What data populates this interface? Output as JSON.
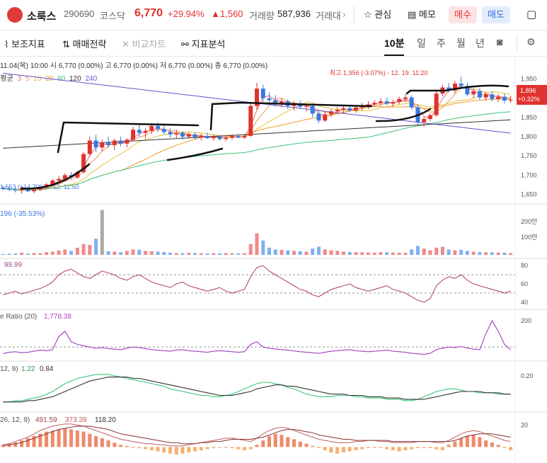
{
  "header": {
    "stock_name": "소룩스",
    "code": "290690",
    "market": "코스닥",
    "price": "6,770",
    "change_pct": "+29.94%",
    "change_amt": "1,560",
    "volume_label": "거래량",
    "volume": "587,936",
    "truncated_label": "거래대",
    "favorite_label": "관심",
    "memo_label": "메모",
    "buy_label": "매수",
    "sell_label": "매도"
  },
  "toolbar": {
    "aux_indicator": "보조지표",
    "trade_strategy": "매매전략",
    "compare_chart": "비교차트",
    "indicator_analysis": "지표분석",
    "timeframes": [
      "10분",
      "일",
      "주",
      "월",
      "년"
    ],
    "active_timeframe": "10분"
  },
  "colors": {
    "up": "#e0322f",
    "down": "#3a78e0",
    "ma3": "#e86d6d",
    "ma5": "#e89a5a",
    "ma10": "#e2c23a",
    "ma20": "#ef9c2a",
    "ma60": "#3cc47a",
    "ma120": "#333333",
    "ma240": "#6a4fd0"
  },
  "chart_data": [
    {
      "type": "candlestick",
      "info_line": "11.04(목) 10:00 시 6,770 (0.00%)  고 6,770 (0.00%)  저 6,770 (0.00%)  종 6,770 (0.00%)",
      "ma_label": "이동평균",
      "ma_periods": [
        "3",
        "5",
        "10",
        "20",
        "60",
        "120",
        "240"
      ],
      "y_ticks": [
        "1,950",
        "1,900",
        "1,850",
        "1,800",
        "1,750",
        "1,700",
        "1,650"
      ],
      "ylim": [
        1640,
        1975
      ],
      "high_annotation": "최고 1,956 (-3.07%) - 12. 19. 11:20",
      "low_annotation": "1,653 (+14.70%) - 12. 11:50",
      "price_tag": "1,896",
      "price_tag_pct": "+0.32%",
      "ohlc": [
        [
          1668,
          1672,
          1660,
          1665
        ],
        [
          1665,
          1670,
          1658,
          1662
        ],
        [
          1662,
          1668,
          1655,
          1660
        ],
        [
          1660,
          1667,
          1652,
          1664
        ],
        [
          1664,
          1670,
          1656,
          1658
        ],
        [
          1658,
          1665,
          1653,
          1662
        ],
        [
          1662,
          1670,
          1658,
          1668
        ],
        [
          1668,
          1680,
          1664,
          1676
        ],
        [
          1676,
          1690,
          1670,
          1686
        ],
        [
          1686,
          1698,
          1680,
          1690
        ],
        [
          1690,
          1705,
          1684,
          1700
        ],
        [
          1700,
          1708,
          1690,
          1694
        ],
        [
          1694,
          1712,
          1690,
          1708
        ],
        [
          1708,
          1760,
          1704,
          1755
        ],
        [
          1755,
          1800,
          1748,
          1790
        ],
        [
          1790,
          1805,
          1760,
          1772
        ],
        [
          1772,
          1792,
          1762,
          1785
        ],
        [
          1785,
          1800,
          1770,
          1778
        ],
        [
          1778,
          1795,
          1765,
          1790
        ],
        [
          1790,
          1800,
          1775,
          1782
        ],
        [
          1782,
          1796,
          1772,
          1792
        ],
        [
          1792,
          1825,
          1788,
          1818
        ],
        [
          1818,
          1832,
          1800,
          1810
        ],
        [
          1810,
          1822,
          1795,
          1815
        ],
        [
          1815,
          1835,
          1808,
          1828
        ],
        [
          1828,
          1838,
          1812,
          1820
        ],
        [
          1820,
          1830,
          1806,
          1812
        ],
        [
          1812,
          1822,
          1798,
          1806
        ],
        [
          1806,
          1818,
          1796,
          1810
        ],
        [
          1810,
          1815,
          1792,
          1800
        ],
        [
          1800,
          1812,
          1794,
          1806
        ],
        [
          1806,
          1812,
          1792,
          1798
        ],
        [
          1798,
          1808,
          1790,
          1802
        ],
        [
          1802,
          1810,
          1794,
          1796
        ],
        [
          1796,
          1806,
          1790,
          1800
        ],
        [
          1800,
          1805,
          1790,
          1794
        ],
        [
          1794,
          1804,
          1788,
          1798
        ],
        [
          1798,
          1806,
          1792,
          1802
        ],
        [
          1802,
          1806,
          1796,
          1798
        ],
        [
          1798,
          1805,
          1794,
          1802
        ],
        [
          1802,
          1890,
          1800,
          1880
        ],
        [
          1880,
          1940,
          1870,
          1925
        ],
        [
          1925,
          1935,
          1890,
          1900
        ],
        [
          1900,
          1915,
          1885,
          1895
        ],
        [
          1895,
          1908,
          1878,
          1888
        ],
        [
          1888,
          1900,
          1876,
          1892
        ],
        [
          1892,
          1898,
          1872,
          1880
        ],
        [
          1880,
          1892,
          1868,
          1886
        ],
        [
          1886,
          1894,
          1872,
          1878
        ],
        [
          1878,
          1886,
          1866,
          1880
        ],
        [
          1880,
          1886,
          1850,
          1860
        ],
        [
          1860,
          1868,
          1835,
          1842
        ],
        [
          1842,
          1864,
          1838,
          1858
        ],
        [
          1858,
          1872,
          1852,
          1866
        ],
        [
          1866,
          1878,
          1858,
          1870
        ],
        [
          1870,
          1880,
          1860,
          1874
        ],
        [
          1874,
          1882,
          1864,
          1868
        ],
        [
          1868,
          1880,
          1862,
          1876
        ],
        [
          1876,
          1888,
          1868,
          1880
        ],
        [
          1880,
          1892,
          1872,
          1884
        ],
        [
          1884,
          1895,
          1876,
          1888
        ],
        [
          1888,
          1900,
          1880,
          1892
        ],
        [
          1892,
          1902,
          1882,
          1886
        ],
        [
          1886,
          1896,
          1878,
          1890
        ],
        [
          1890,
          1904,
          1884,
          1898
        ],
        [
          1898,
          1910,
          1890,
          1902
        ],
        [
          1902,
          1908,
          1870,
          1876
        ],
        [
          1876,
          1884,
          1830,
          1838
        ],
        [
          1838,
          1852,
          1826,
          1846
        ],
        [
          1846,
          1860,
          1840,
          1856
        ],
        [
          1856,
          1920,
          1852,
          1912
        ],
        [
          1912,
          1935,
          1905,
          1928
        ],
        [
          1928,
          1940,
          1915,
          1920
        ],
        [
          1920,
          1945,
          1912,
          1938
        ],
        [
          1938,
          1956,
          1925,
          1932
        ],
        [
          1932,
          1940,
          1905,
          1910
        ],
        [
          1910,
          1925,
          1900,
          1918
        ],
        [
          1918,
          1926,
          1896,
          1902
        ],
        [
          1902,
          1916,
          1894,
          1910
        ],
        [
          1910,
          1918,
          1892,
          1898
        ],
        [
          1898,
          1910,
          1890,
          1904
        ],
        [
          1904,
          1912,
          1886,
          1894
        ],
        [
          1894,
          1906,
          1888,
          1896
        ]
      ]
    },
    {
      "type": "bar",
      "label": "거래량",
      "value_label": "196 (-35.53%)",
      "y_ticks": [
        "200만",
        "100만"
      ],
      "values": [
        5,
        6,
        8,
        12,
        7,
        10,
        9,
        15,
        18,
        25,
        30,
        22,
        40,
        60,
        55,
        90,
        35,
        20,
        18,
        15,
        22,
        30,
        28,
        22,
        20,
        18,
        16,
        12,
        10,
        9,
        11,
        10,
        9,
        8,
        9,
        8,
        10,
        9,
        8,
        9,
        60,
        120,
        80,
        40,
        30,
        28,
        25,
        22,
        20,
        18,
        35,
        45,
        30,
        25,
        22,
        18,
        16,
        15,
        14,
        13,
        12,
        15,
        14,
        13,
        12,
        11,
        30,
        50,
        35,
        25,
        40,
        45,
        30,
        25,
        28,
        22,
        18,
        16,
        15,
        14,
        13,
        12,
        10
      ],
      "spike_index": 16,
      "spike_value": 250
    },
    {
      "type": "line",
      "label": "",
      "value_label": "99.99",
      "y_ticks": [
        "80",
        "60",
        "40"
      ],
      "ylim": [
        36,
        84
      ],
      "values": [
        48,
        50,
        52,
        49,
        51,
        53,
        55,
        58,
        62,
        70,
        74,
        76,
        72,
        68,
        66,
        70,
        74,
        72,
        70,
        66,
        64,
        68,
        70,
        66,
        62,
        60,
        58,
        56,
        60,
        62,
        58,
        56,
        54,
        52,
        54,
        56,
        52,
        50,
        52,
        54,
        68,
        78,
        80,
        74,
        70,
        66,
        62,
        58,
        54,
        52,
        48,
        46,
        50,
        54,
        56,
        58,
        60,
        56,
        54,
        52,
        54,
        56,
        58,
        54,
        52,
        50,
        46,
        42,
        40,
        44,
        58,
        64,
        68,
        66,
        70,
        64,
        60,
        58,
        56,
        54,
        52,
        50,
        52
      ],
      "dashed_levels": [
        70,
        50
      ]
    },
    {
      "type": "line",
      "label": "e Ratio (20)",
      "value_label": "1,778.38",
      "y_ticks": [
        "200"
      ],
      "ylim": [
        60,
        230
      ],
      "values": [
        75,
        80,
        82,
        78,
        80,
        84,
        88,
        86,
        90,
        140,
        160,
        120,
        110,
        105,
        100,
        95,
        98,
        94,
        92,
        90,
        96,
        100,
        98,
        94,
        90,
        88,
        86,
        84,
        88,
        90,
        86,
        84,
        82,
        80,
        84,
        86,
        84,
        82,
        80,
        82,
        110,
        120,
        100,
        95,
        92,
        90,
        88,
        85,
        82,
        80,
        78,
        76,
        80,
        84,
        86,
        88,
        90,
        86,
        84,
        82,
        84,
        86,
        88,
        84,
        82,
        80,
        76,
        74,
        72,
        76,
        90,
        96,
        100,
        98,
        102,
        96,
        92,
        90,
        150,
        200,
        160,
        110,
        90
      ],
      "dashed_levels": [
        100
      ]
    },
    {
      "type": "line",
      "label": "",
      "params": "12, 9)",
      "values_label": [
        "1.22",
        "0.84"
      ],
      "y_ticks": [
        "0.20"
      ],
      "ylim": [
        -0.05,
        0.28
      ],
      "series": [
        {
          "name": "1.22",
          "values": [
            0.0,
            0.0,
            0.01,
            0.01,
            0.02,
            0.03,
            0.04,
            0.06,
            0.08,
            0.11,
            0.14,
            0.16,
            0.18,
            0.19,
            0.2,
            0.21,
            0.21,
            0.21,
            0.2,
            0.19,
            0.18,
            0.17,
            0.16,
            0.15,
            0.14,
            0.13,
            0.12,
            0.1,
            0.09,
            0.08,
            0.07,
            0.06,
            0.05,
            0.05,
            0.04,
            0.04,
            0.05,
            0.06,
            0.08,
            0.1,
            0.12,
            0.14,
            0.15,
            0.15,
            0.14,
            0.13,
            0.11,
            0.1,
            0.08,
            0.06,
            0.05,
            0.04,
            0.04,
            0.04,
            0.05,
            0.05,
            0.05,
            0.04,
            0.04,
            0.03,
            0.03,
            0.03,
            0.02,
            0.02,
            0.02,
            0.01,
            0.01,
            0.02,
            0.04,
            0.06,
            0.08,
            0.09,
            0.1,
            0.1,
            0.09,
            0.08,
            0.08,
            0.07,
            0.07,
            0.07,
            0.06,
            0.06,
            0.06
          ]
        },
        {
          "name": "0.84",
          "values": [
            0.0,
            0.0,
            0.0,
            0.0,
            0.01,
            0.01,
            0.02,
            0.03,
            0.04,
            0.06,
            0.08,
            0.1,
            0.12,
            0.14,
            0.16,
            0.17,
            0.18,
            0.19,
            0.19,
            0.19,
            0.19,
            0.18,
            0.18,
            0.17,
            0.16,
            0.15,
            0.14,
            0.13,
            0.12,
            0.11,
            0.1,
            0.09,
            0.08,
            0.07,
            0.06,
            0.05,
            0.05,
            0.05,
            0.06,
            0.07,
            0.08,
            0.1,
            0.11,
            0.12,
            0.13,
            0.13,
            0.12,
            0.12,
            0.11,
            0.1,
            0.09,
            0.08,
            0.07,
            0.06,
            0.06,
            0.06,
            0.05,
            0.05,
            0.05,
            0.04,
            0.04,
            0.04,
            0.03,
            0.03,
            0.03,
            0.02,
            0.02,
            0.02,
            0.02,
            0.03,
            0.04,
            0.05,
            0.06,
            0.07,
            0.08,
            0.08,
            0.08,
            0.08,
            0.07,
            0.07,
            0.07,
            0.06,
            0.06
          ]
        }
      ]
    },
    {
      "type": "bar",
      "label": "",
      "params": "26, 12, 9)",
      "values_label": [
        "491.59",
        "373.39",
        "118.20"
      ],
      "y_ticks": [
        "20"
      ],
      "ylim": [
        -12,
        28
      ],
      "values": [
        2,
        3,
        4,
        6,
        8,
        10,
        12,
        14,
        15,
        16,
        17,
        16,
        15,
        14,
        12,
        10,
        8,
        6,
        4,
        2,
        1,
        0,
        -1,
        -2,
        -3,
        -4,
        -5,
        -6,
        -7,
        -6,
        -5,
        -4,
        -3,
        -2,
        -1,
        0,
        0,
        -1,
        -2,
        -3,
        -2,
        2,
        6,
        10,
        12,
        11,
        9,
        7,
        5,
        3,
        1,
        -1,
        -3,
        -5,
        -6,
        -5,
        -4,
        -3,
        -2,
        -1,
        0,
        -1,
        -2,
        -3,
        -4,
        -3,
        -2,
        -1,
        0,
        -1,
        -2,
        -3,
        2,
        5,
        8,
        10,
        11,
        9,
        6,
        4,
        2,
        -1,
        -3
      ],
      "lines": [
        [
          2,
          3,
          5,
          7,
          9,
          12,
          15,
          17,
          19,
          20,
          21,
          21,
          20,
          19,
          17,
          15,
          13,
          11,
          9,
          7,
          6,
          5,
          4,
          3,
          3,
          2,
          2,
          1,
          1,
          1,
          2,
          3,
          4,
          5,
          6,
          7,
          8,
          8,
          7,
          6,
          5,
          8,
          12,
          15,
          17,
          18,
          17,
          15,
          13,
          11,
          9,
          7,
          6,
          5,
          4,
          4,
          4,
          5,
          5,
          6,
          6,
          5,
          5,
          4,
          4,
          4,
          4,
          5,
          5,
          5,
          4,
          4,
          6,
          9,
          12,
          14,
          15,
          14,
          12,
          10,
          8,
          6,
          5
        ],
        [
          1,
          2,
          3,
          4,
          6,
          8,
          10,
          12,
          14,
          16,
          17,
          18,
          19,
          19,
          19,
          18,
          17,
          16,
          14,
          12,
          11,
          10,
          9,
          8,
          7,
          6,
          5,
          4,
          4,
          3,
          3,
          3,
          4,
          4,
          5,
          5,
          6,
          7,
          7,
          7,
          7,
          8,
          9,
          11,
          13,
          15,
          16,
          16,
          15,
          14,
          13,
          11,
          10,
          9,
          8,
          7,
          7,
          6,
          6,
          6,
          6,
          6,
          6,
          5,
          5,
          5,
          5,
          5,
          5,
          5,
          5,
          5,
          5,
          6,
          8,
          10,
          11,
          12,
          12,
          12,
          11,
          10,
          9
        ]
      ]
    }
  ]
}
